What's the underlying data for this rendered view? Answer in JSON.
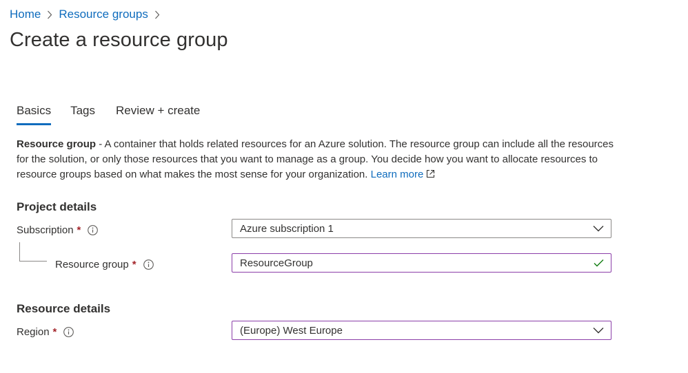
{
  "breadcrumb": {
    "items": [
      "Home",
      "Resource groups"
    ]
  },
  "page": {
    "title": "Create a resource group"
  },
  "tabs": [
    {
      "label": "Basics",
      "active": true
    },
    {
      "label": "Tags",
      "active": false
    },
    {
      "label": "Review + create",
      "active": false
    }
  ],
  "description": {
    "term": "Resource group",
    "text": " - A container that holds related resources for an Azure solution. The resource group can include all the resources for the solution, or only those resources that you want to manage as a group. You decide how you want to allocate resources to resource groups based on what makes the most sense for your organization. ",
    "learn_more": "Learn more"
  },
  "project_details": {
    "title": "Project details",
    "subscription": {
      "label": "Subscription",
      "required": "*",
      "value": "Azure subscription 1"
    },
    "resource_group": {
      "label": "Resource group",
      "required": "*",
      "value": "ResourceGroup",
      "valid": true
    }
  },
  "resource_details": {
    "title": "Resource details",
    "region": {
      "label": "Region",
      "required": "*",
      "value": "(Europe) West Europe"
    }
  },
  "colors": {
    "link": "#0f6cbd",
    "required": "#a4262c",
    "focus_border": "#8a3da8",
    "valid": "#107c10"
  }
}
